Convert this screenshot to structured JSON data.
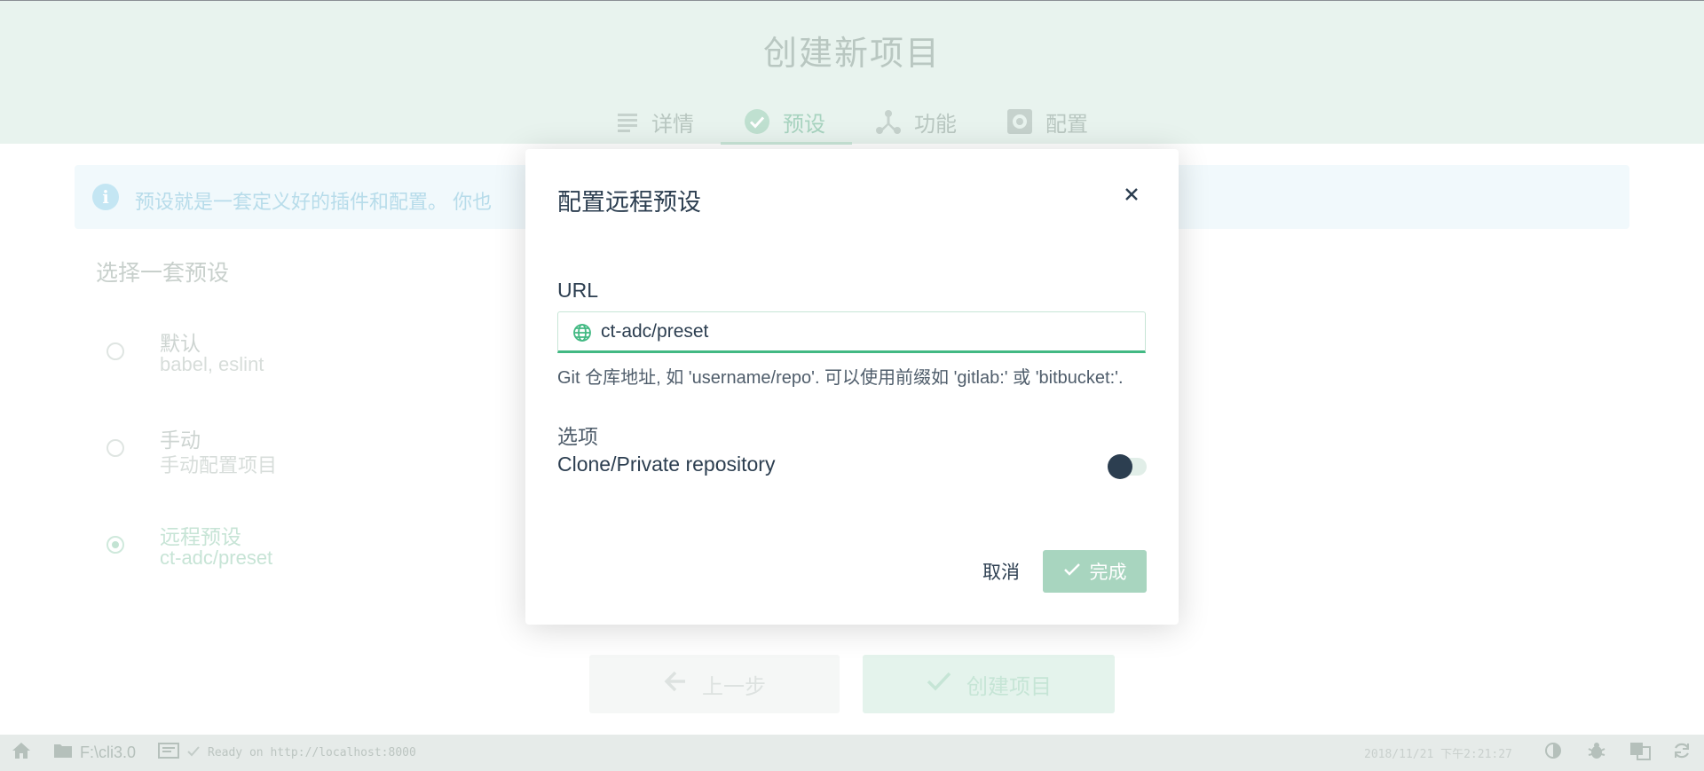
{
  "page": {
    "title": "创建新项目",
    "steps": [
      {
        "label": "详情",
        "icon": "list-icon"
      },
      {
        "label": "预设",
        "icon": "check-circle-icon",
        "active": true
      },
      {
        "label": "功能",
        "icon": "merge-icon"
      },
      {
        "label": "配置",
        "icon": "settings-icon"
      }
    ],
    "info_text": "预设就是一套定义好的插件和配置。 你也",
    "section_title": "选择一套预设",
    "presets": [
      {
        "name": "默认",
        "desc": "babel, eslint",
        "selected": false
      },
      {
        "name": "手动",
        "desc": "手动配置项目",
        "selected": false
      },
      {
        "name": "远程预设",
        "desc": "ct-adc/preset",
        "selected": true
      }
    ],
    "prev_button": "上一步",
    "create_button": "创建项目"
  },
  "status_bar": {
    "folder": "F:\\cli3.0",
    "log": "Ready on http://localhost:8000",
    "time": "2018/11/21 下午2:21:27"
  },
  "dialog": {
    "title": "配置远程预设",
    "url_label": "URL",
    "url_value": "ct-adc/preset",
    "url_help": "Git 仓库地址, 如 'username/repo'. 可以使用前缀如 'gitlab:' 或 'bitbucket:'.",
    "options_label": "选项",
    "clone_label": "Clone/Private repository",
    "clone_enabled": false,
    "cancel_label": "取消",
    "done_label": "完成"
  },
  "colors": {
    "accent": "#42b983",
    "text": "#2c3e50",
    "header_bg": "#e8f3ee"
  }
}
